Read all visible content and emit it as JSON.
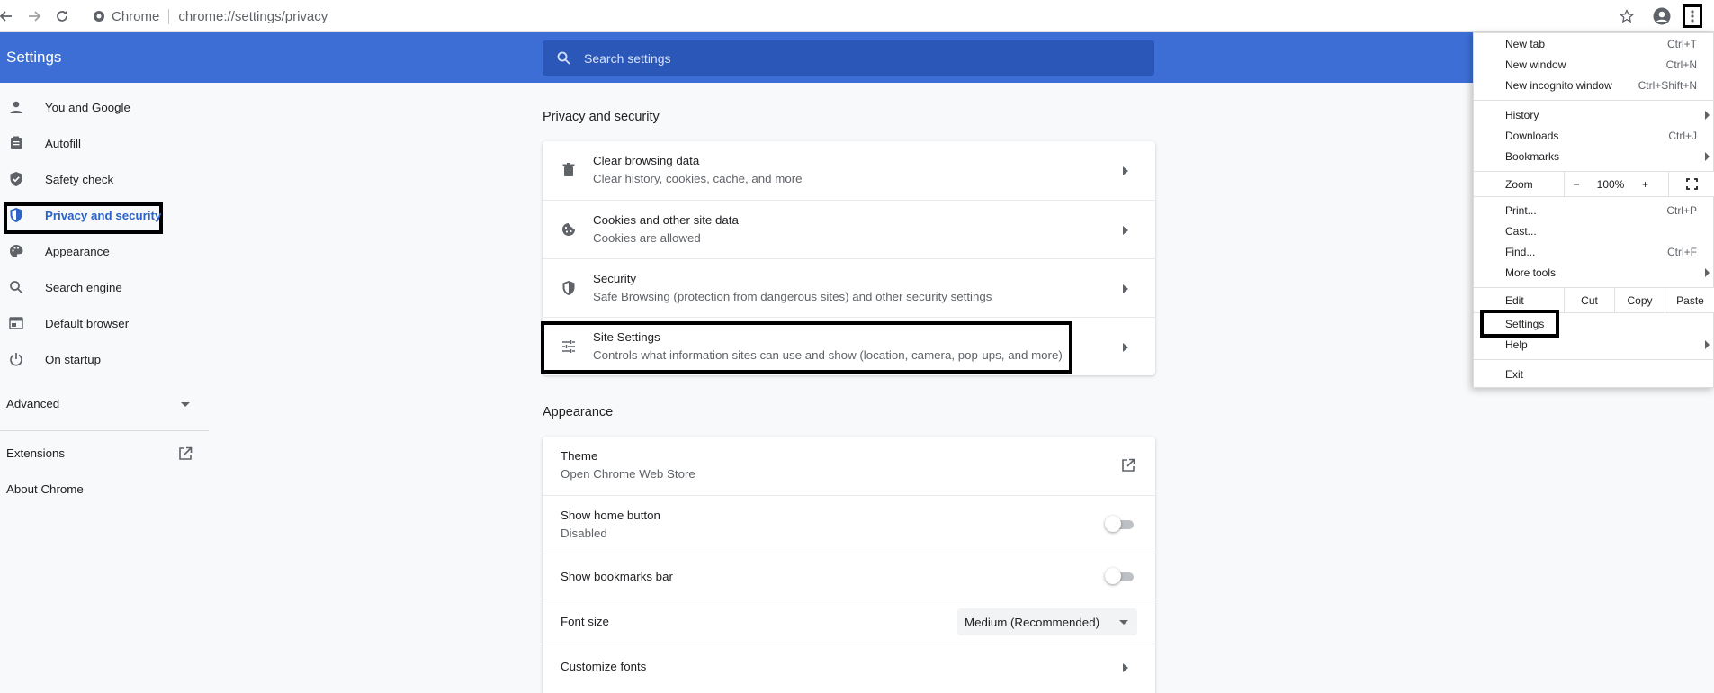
{
  "browser": {
    "site_name": "Chrome",
    "url": "chrome://settings/privacy"
  },
  "header": {
    "title": "Settings",
    "search_placeholder": "Search settings"
  },
  "sidebar": {
    "items": [
      {
        "label": "You and Google",
        "icon": "person-icon"
      },
      {
        "label": "Autofill",
        "icon": "clipboard-icon"
      },
      {
        "label": "Safety check",
        "icon": "shield-check-icon"
      },
      {
        "label": "Privacy and security",
        "icon": "shield-icon"
      },
      {
        "label": "Appearance",
        "icon": "palette-icon"
      },
      {
        "label": "Search engine",
        "icon": "search-icon"
      },
      {
        "label": "Default browser",
        "icon": "browser-icon"
      },
      {
        "label": "On startup",
        "icon": "power-icon"
      }
    ],
    "active": "Privacy and security",
    "advanced": "Advanced",
    "extensions": "Extensions",
    "about": "About Chrome"
  },
  "privacy": {
    "title": "Privacy and security",
    "rows": [
      {
        "title": "Clear browsing data",
        "subtitle": "Clear history, cookies, cache, and more",
        "icon": "trash-icon"
      },
      {
        "title": "Cookies and other site data",
        "subtitle": "Cookies are allowed",
        "icon": "cookie-icon"
      },
      {
        "title": "Security",
        "subtitle": "Safe Browsing (protection from dangerous sites) and other security settings",
        "icon": "shield-icon"
      },
      {
        "title": "Site Settings",
        "subtitle": "Controls what information sites can use and show (location, camera, pop-ups, and more)",
        "icon": "sliders-icon"
      }
    ]
  },
  "appearance": {
    "title": "Appearance",
    "theme_title": "Theme",
    "theme_sub": "Open Chrome Web Store",
    "home_title": "Show home button",
    "home_sub": "Disabled",
    "home_enabled": false,
    "bookmarks_title": "Show bookmarks bar",
    "bookmarks_enabled": false,
    "font_size_title": "Font size",
    "font_size_value": "Medium (Recommended)",
    "customize_fonts": "Customize fonts"
  },
  "menu": {
    "items_top": [
      {
        "label": "New tab",
        "shortcut": "Ctrl+T"
      },
      {
        "label": "New window",
        "shortcut": "Ctrl+N"
      },
      {
        "label": "New incognito window",
        "shortcut": "Ctrl+Shift+N"
      }
    ],
    "items_mid": [
      {
        "label": "History",
        "submenu": true
      },
      {
        "label": "Downloads",
        "shortcut": "Ctrl+J"
      },
      {
        "label": "Bookmarks",
        "submenu": true
      }
    ],
    "zoom_label": "Zoom",
    "zoom_minus": "−",
    "zoom_value": "100%",
    "zoom_plus": "+",
    "items_tools": [
      {
        "label": "Print...",
        "shortcut": "Ctrl+P"
      },
      {
        "label": "Cast..."
      },
      {
        "label": "Find...",
        "shortcut": "Ctrl+F"
      },
      {
        "label": "More tools",
        "submenu": true
      }
    ],
    "edit_label": "Edit",
    "cut": "Cut",
    "copy": "Copy",
    "paste": "Paste",
    "settings": "Settings",
    "help": "Help",
    "exit": "Exit"
  }
}
